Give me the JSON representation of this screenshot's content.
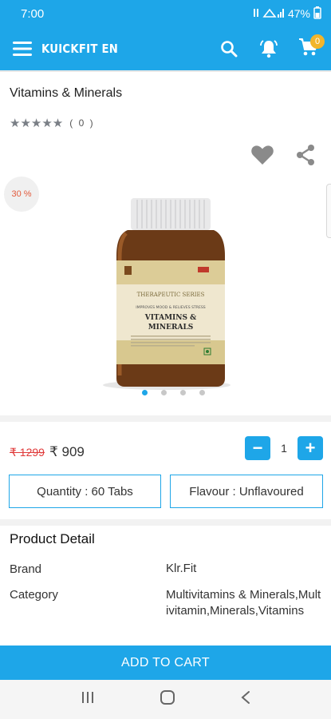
{
  "status_bar": {
    "time": "7:00",
    "battery": "47%"
  },
  "app_bar": {
    "title": "KUICKFIT EN",
    "cart_count": "0"
  },
  "product": {
    "title": "Vitamins & Minerals",
    "rating_count": "( 0 )",
    "discount": "30 %",
    "old_price": "₹ 1299",
    "new_price": "₹ 909",
    "image_alt": "Vitamins & Minerals",
    "label_line1": "THERAPEUTIC SERIES",
    "label_line2": "IMPROVES MOOD & RELIEVES STRESS",
    "label_line3": "VITAMINS &",
    "label_line4": "MINERALS",
    "image_count": 4,
    "active_image": 0
  },
  "quantity": {
    "value": "1",
    "minus": "−",
    "plus": "+"
  },
  "variants": {
    "quantity": "Quantity : 60 Tabs",
    "flavour": "Flavour : Unflavoured"
  },
  "details": {
    "section_title": "Product Detail",
    "rows": [
      {
        "label": "Brand",
        "value": "Klr.Fit"
      },
      {
        "label": "Category",
        "value": "Multivitamins & Minerals,Multivitamin,Minerals,Vitamins"
      }
    ]
  },
  "cta": {
    "add_to_cart": "ADD TO CART"
  },
  "colors": {
    "primary": "#1ea6e8",
    "old_price": "#e03a3a",
    "badge": "#f2b52b"
  }
}
